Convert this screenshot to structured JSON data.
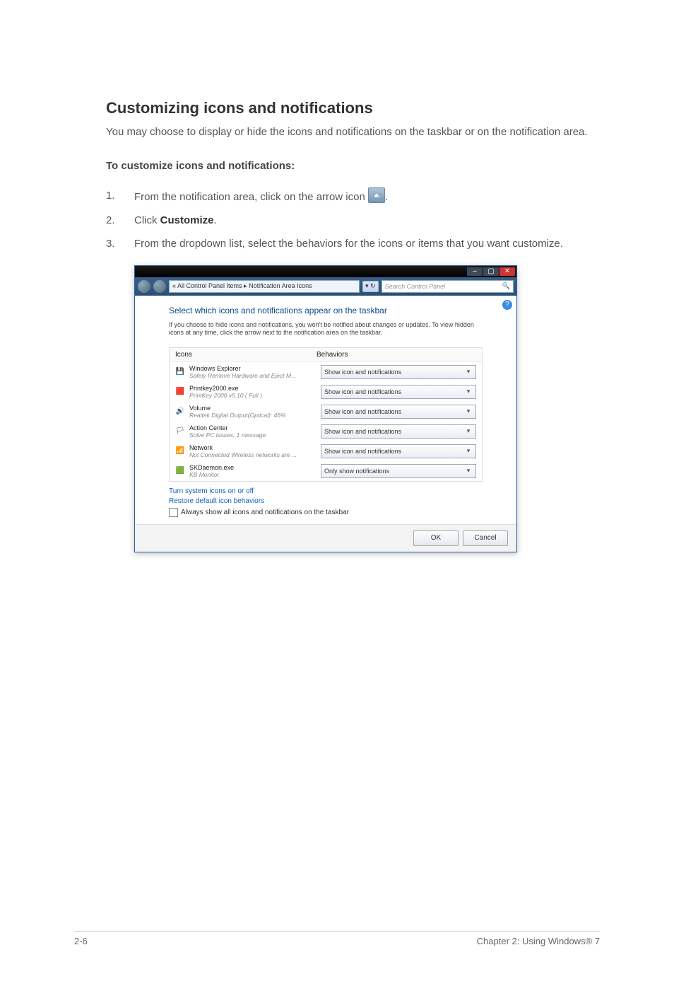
{
  "section": {
    "title": "Customizing icons and notifications",
    "intro": "You may choose to display or hide the icons and notifications on the taskbar or on the notification area.",
    "sub_heading": "To customize icons and notifications:",
    "steps": [
      {
        "num": "1.",
        "text_before": "From the notification area, click on the arrow icon ",
        "text_after": "."
      },
      {
        "num": "2.",
        "text_before": "Click ",
        "bold": "Customize",
        "text_after": "."
      },
      {
        "num": "3.",
        "text_before": "From the dropdown list, select the behaviors for the icons or items that you want customize."
      }
    ]
  },
  "window": {
    "titlebar": {
      "min": "–",
      "max": "▢",
      "close": "✕"
    },
    "address": {
      "breadcrumb": "« All Control Panel Items ▸ Notification Area Icons",
      "refresh_seg": "▾  ↻",
      "search_placeholder": "Search Control Panel",
      "search_icon": "🔍"
    },
    "help": "?",
    "heading": "Select which icons and notifications appear on the taskbar",
    "subtext": "If you choose to hide icons and notifications, you won't be notified about changes or updates. To view hidden icons at any time, click the arrow next to the notification area on the taskbar.",
    "table": {
      "col_icons": "Icons",
      "col_behaviors": "Behaviors",
      "rows": [
        {
          "icon": "💾",
          "title": "Windows Explorer",
          "desc": "Safely Remove Hardware and Eject M...",
          "behavior": "Show icon and notifications"
        },
        {
          "icon": "🟥",
          "title": "Printkey2000.exe",
          "desc": "PrintKey 2000 v5.10 ( Full )",
          "behavior": "Show icon and notifications"
        },
        {
          "icon": "🔊",
          "title": "Volume",
          "desc": "Realtek Digital Output(Optical): 46%",
          "behavior": "Show icon and notifications"
        },
        {
          "icon": "🏳",
          "title": "Action Center",
          "desc": "Solve PC issues: 1 message",
          "behavior": "Show icon and notifications"
        },
        {
          "icon": "📶",
          "title": "Network",
          "desc": "Not Connected Wireless networks are ...",
          "behavior": "Show icon and notifications"
        },
        {
          "icon": "🟩",
          "title": "SKDaemon.exe",
          "desc": "KB Monitor",
          "behavior": "Only show notifications"
        }
      ]
    },
    "links": {
      "l1": "Turn system icons on or off",
      "l2": "Restore default icon behaviors"
    },
    "checkbox_label": "Always show all icons and notifications on the taskbar",
    "buttons": {
      "ok": "OK",
      "cancel": "Cancel"
    }
  },
  "footer": {
    "left": "2-6",
    "right": "Chapter 2: Using Windows® 7"
  }
}
